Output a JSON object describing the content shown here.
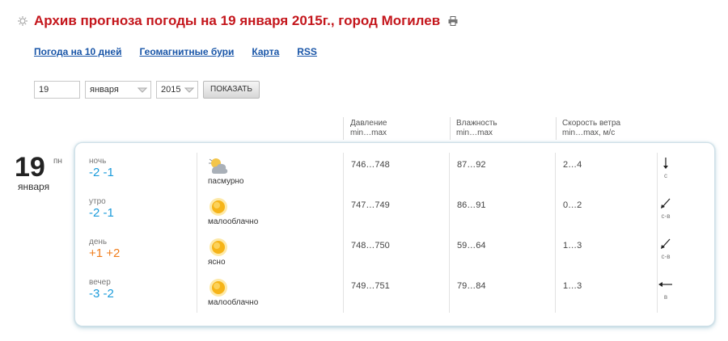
{
  "title": "Архив прогноза погоды на 19 января 2015г., город Могилев",
  "nav": [
    "Погода на 10 дней",
    "Геомагнитные бури",
    "Карта",
    "RSS"
  ],
  "filter": {
    "day": "19",
    "month": "января",
    "year": "2015",
    "button": "ПОКАЗАТЬ"
  },
  "columns": {
    "pressure": {
      "title": "Давление",
      "sub": "min…max"
    },
    "humidity": {
      "title": "Влажность",
      "sub": "min…max"
    },
    "wind": {
      "title": "Скорость ветра",
      "sub": "min…max, м/с"
    }
  },
  "date": {
    "day": "19",
    "dow": "пн",
    "month": "января"
  },
  "rows": [
    {
      "period": "ночь",
      "temp": "-2 -1",
      "icon": "overcast-icon",
      "condition": "пасмурно",
      "pressure": "746…748",
      "humidity": "87…92",
      "wind": "2…4",
      "wind_dir": "с",
      "wind_icon": "arrow-down-icon"
    },
    {
      "period": "утро",
      "temp": "-2 -1",
      "icon": "sun-icon",
      "condition": "малооблачно",
      "pressure": "747…749",
      "humidity": "86…91",
      "wind": "0…2",
      "wind_dir": "с-в",
      "wind_icon": "arrow-down-left-icon"
    },
    {
      "period": "день",
      "temp": "+1 +2",
      "icon": "sun-icon",
      "condition": "ясно",
      "pressure": "748…750",
      "humidity": "59…64",
      "wind": "1…3",
      "wind_dir": "с-в",
      "wind_icon": "arrow-down-left-icon"
    },
    {
      "period": "вечер",
      "temp": "-3 -2",
      "icon": "sun-icon",
      "condition": "малооблачно",
      "pressure": "749…751",
      "humidity": "79…84",
      "wind": "1…3",
      "wind_dir": "в",
      "wind_icon": "arrow-left-icon"
    }
  ],
  "colors": {
    "title": "#c4161c",
    "link": "#1a56a8",
    "cold_temp": "#1a9bdb",
    "warm_temp": "#f07d1c"
  }
}
